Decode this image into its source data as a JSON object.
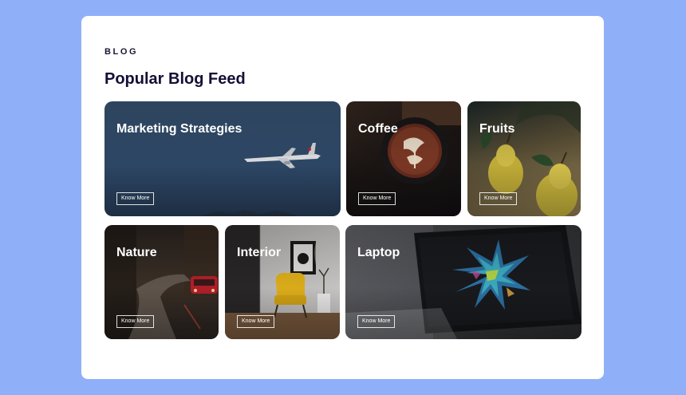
{
  "section": {
    "eyebrow": "BLOG",
    "title": "Popular Blog Feed"
  },
  "tiles": [
    {
      "title": "Marketing Strategies",
      "button": "Know More",
      "image": "airplane-sky-photo"
    },
    {
      "title": "Coffee",
      "button": "Know More",
      "image": "latte-art-photo"
    },
    {
      "title": "Fruits",
      "button": "Know More",
      "image": "pears-photo"
    },
    {
      "title": "Nature",
      "button": "Know More",
      "image": "forest-road-car-photo"
    },
    {
      "title": "Interior",
      "button": "Know More",
      "image": "yellow-chair-room-photo"
    },
    {
      "title": "Laptop",
      "button": "Know More",
      "image": "laptop-screen-photo"
    }
  ],
  "colors": {
    "page_background": "#8fb0f9",
    "card_background": "#ffffff",
    "heading": "#150f36"
  }
}
